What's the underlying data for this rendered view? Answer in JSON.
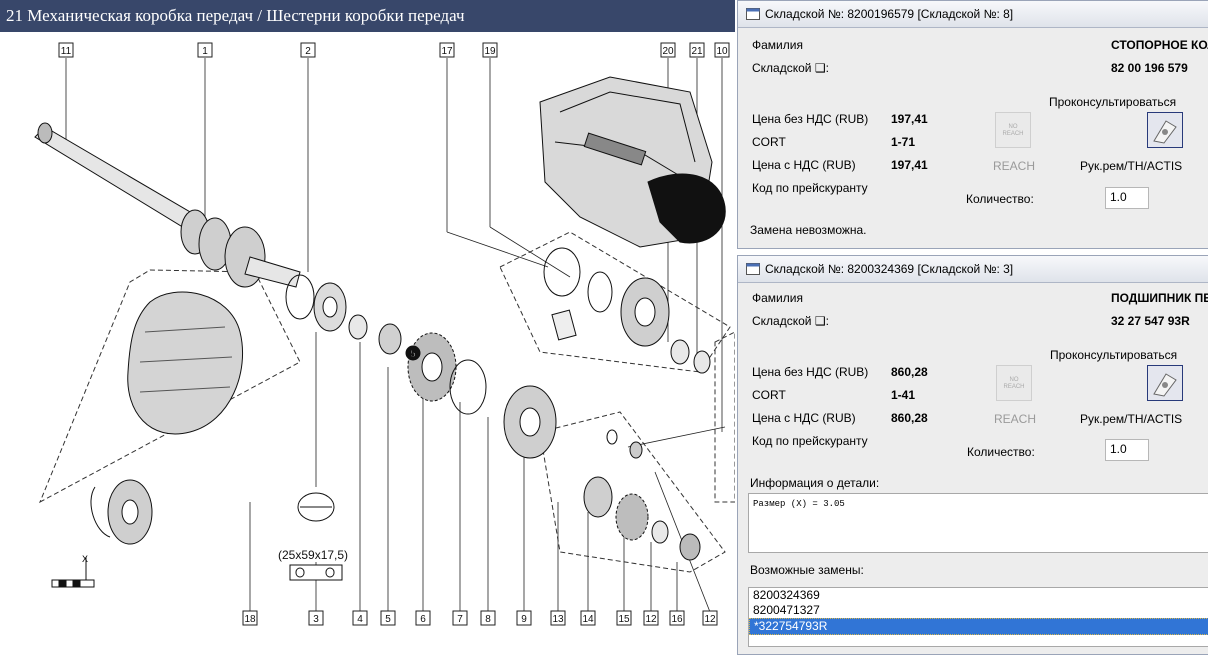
{
  "catalog": {
    "title": "21 Механическая коробка передач / Шестерни коробки передач",
    "callouts": [
      "11",
      "1",
      "2",
      "17",
      "19",
      "20",
      "21",
      "10",
      "18",
      "3",
      "4",
      "5",
      "6",
      "7",
      "8",
      "9",
      "13",
      "14",
      "15",
      "12",
      "16",
      "12"
    ],
    "bearing_dimensions": "(25x59x17,5)",
    "highlight_ref": "5",
    "dimension_marker": "X"
  },
  "windows": [
    {
      "title": "Складской №: 8200196579 [Складской №: 8]",
      "surname_label": "Фамилия",
      "surname_value": "СТОПОРНОЕ КОЛ",
      "stock_label": "Складской ❑:",
      "stock_value": "82 00 196 579",
      "consult_label": "Проконсультироваться",
      "price_no_vat_label": "Цена без НДС (RUB)",
      "price_no_vat": "197,41",
      "cort_label": "CORT",
      "cort": "1-71",
      "price_vat_label": "Цена с НДС (RUB)",
      "price_vat": "197,41",
      "pricelist_label": "Код по прейскуранту",
      "reach_label": "REACH",
      "manual_label": "Рук.рем/TH/ACTIS",
      "qty_label": "Количество:",
      "qty_value": "1.0",
      "footer": "Замена невозможна."
    },
    {
      "title": "Складской №: 8200324369 [Складской №: 3]",
      "surname_label": "Фамилия",
      "surname_value": "ПОДШИПНИК ПЕ",
      "stock_label": "Складской ❑:",
      "stock_value": "32 27 547 93R",
      "consult_label": "Проконсультироваться",
      "price_no_vat_label": "Цена без НДС (RUB)",
      "price_no_vat": "860,28",
      "cort_label": "CORT",
      "cort": "1-41",
      "price_vat_label": "Цена с НДС (RUB)",
      "price_vat": "860,28",
      "pricelist_label": "Код по прейскуранту",
      "reach_label": "REACH",
      "manual_label": "Рук.рем/TH/ACTIS",
      "qty_label": "Количество:",
      "qty_value": "1.0",
      "info_label": "Информация о детали:",
      "info_text": "Размер (X) = 3.05",
      "replacements_label": "Возможные замены:",
      "replacements": [
        "8200324369",
        "8200471327",
        "*322754793R"
      ],
      "selected_replacement": 2
    }
  ],
  "icons": {
    "window": "app-window-icon",
    "reach": "reach-placeholder-icon",
    "consult": "consult-document-icon"
  },
  "colors": {
    "title_bar": "#38476a",
    "selection": "#3175d6",
    "window_bg": "#ededed"
  }
}
